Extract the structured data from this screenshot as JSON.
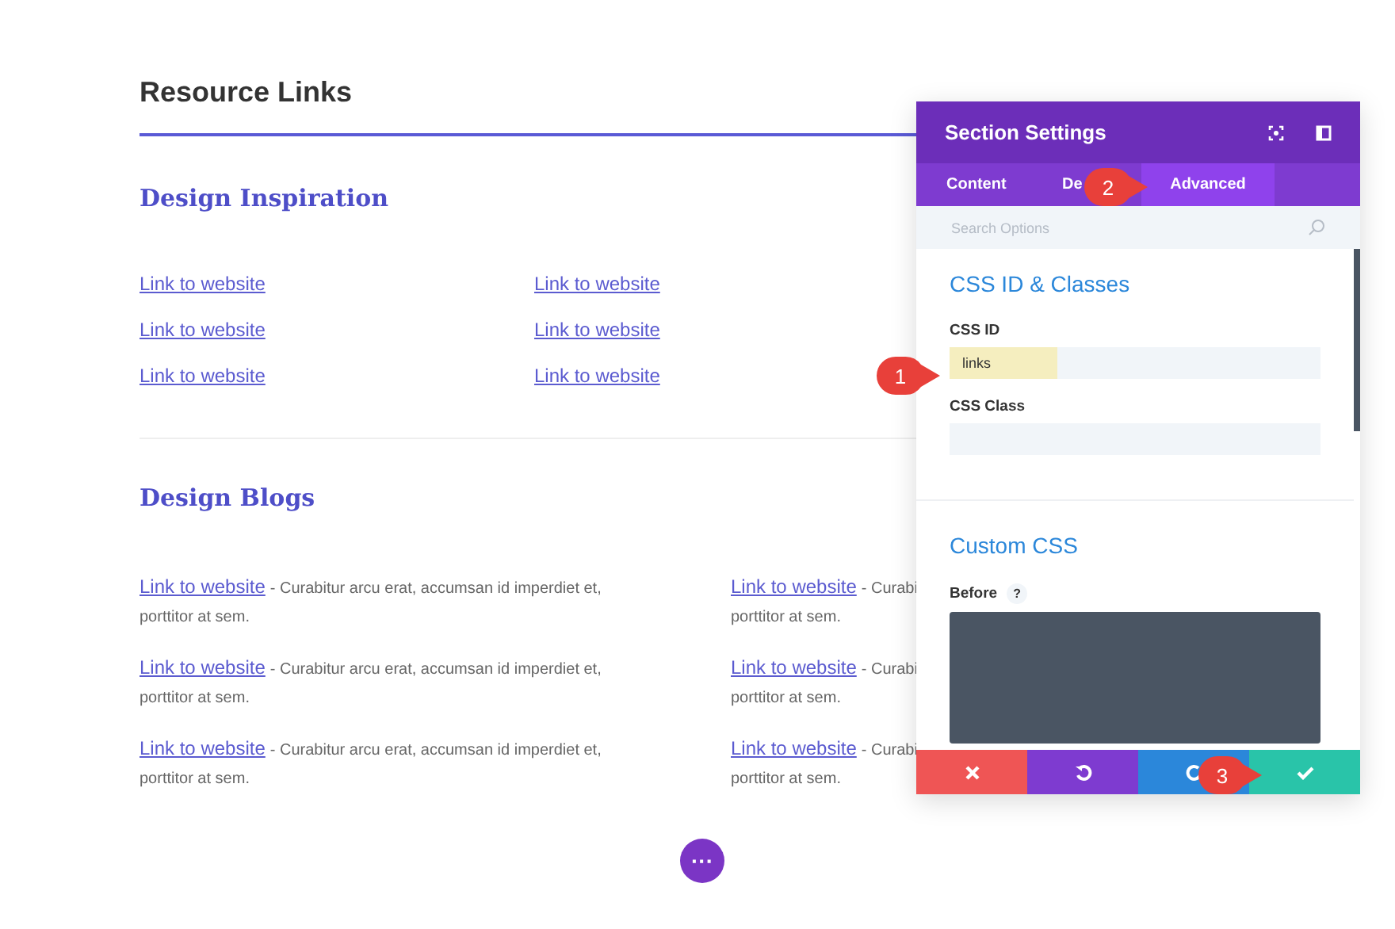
{
  "page": {
    "title": "Resource Links",
    "inspiration": {
      "heading": "Design Inspiration",
      "links": [
        "Link to website",
        "Link to website",
        "Link to website",
        "Link to website",
        "Link to website",
        "Link to website"
      ]
    },
    "blogs": {
      "heading": "Design Blogs",
      "columns": [
        [
          {
            "link": "Link to website",
            "text": "- Curabitur arcu erat, accumsan id imperdiet et,",
            "continuation": "porttitor at sem."
          },
          {
            "link": "Link to website",
            "text": "- Curabitur arcu erat, accumsan id imperdiet et,",
            "continuation": "porttitor at sem."
          },
          {
            "link": "Link to website",
            "text": "- Curabitur arcu erat, accumsan id imperdiet et,",
            "continuation": "porttitor at sem."
          }
        ],
        [
          {
            "link": "Link to website",
            "text": "- Curabi",
            "continuation": "porttitor at sem."
          },
          {
            "link": "Link to website",
            "text": "- Curabi",
            "continuation": "porttitor at sem."
          },
          {
            "link": "Link to website",
            "text": "- Curabi",
            "continuation": "porttitor at sem."
          }
        ]
      ]
    },
    "more_button": "···"
  },
  "panel": {
    "title": "Section Settings",
    "tabs": [
      {
        "label": "Content",
        "selected": false
      },
      {
        "label": "De",
        "selected": false
      },
      {
        "label": "Advanced",
        "selected": true
      }
    ],
    "search": {
      "placeholder": "Search Options"
    },
    "sections": [
      {
        "heading": "CSS ID & Classes",
        "fields": [
          {
            "kind": "input",
            "label": "CSS ID",
            "value": "links",
            "highlighted": true
          },
          {
            "kind": "input",
            "label": "CSS Class"
          }
        ]
      },
      {
        "heading": "Custom CSS",
        "fields": [
          {
            "kind": "textarea",
            "label": "Before",
            "help": "?"
          }
        ]
      }
    ],
    "footer": [
      {
        "kind": "cancel"
      },
      {
        "kind": "undo"
      },
      {
        "kind": "redo"
      },
      {
        "kind": "save"
      }
    ]
  },
  "callouts": [
    {
      "number": "1"
    },
    {
      "number": "2"
    },
    {
      "number": "3"
    }
  ]
}
